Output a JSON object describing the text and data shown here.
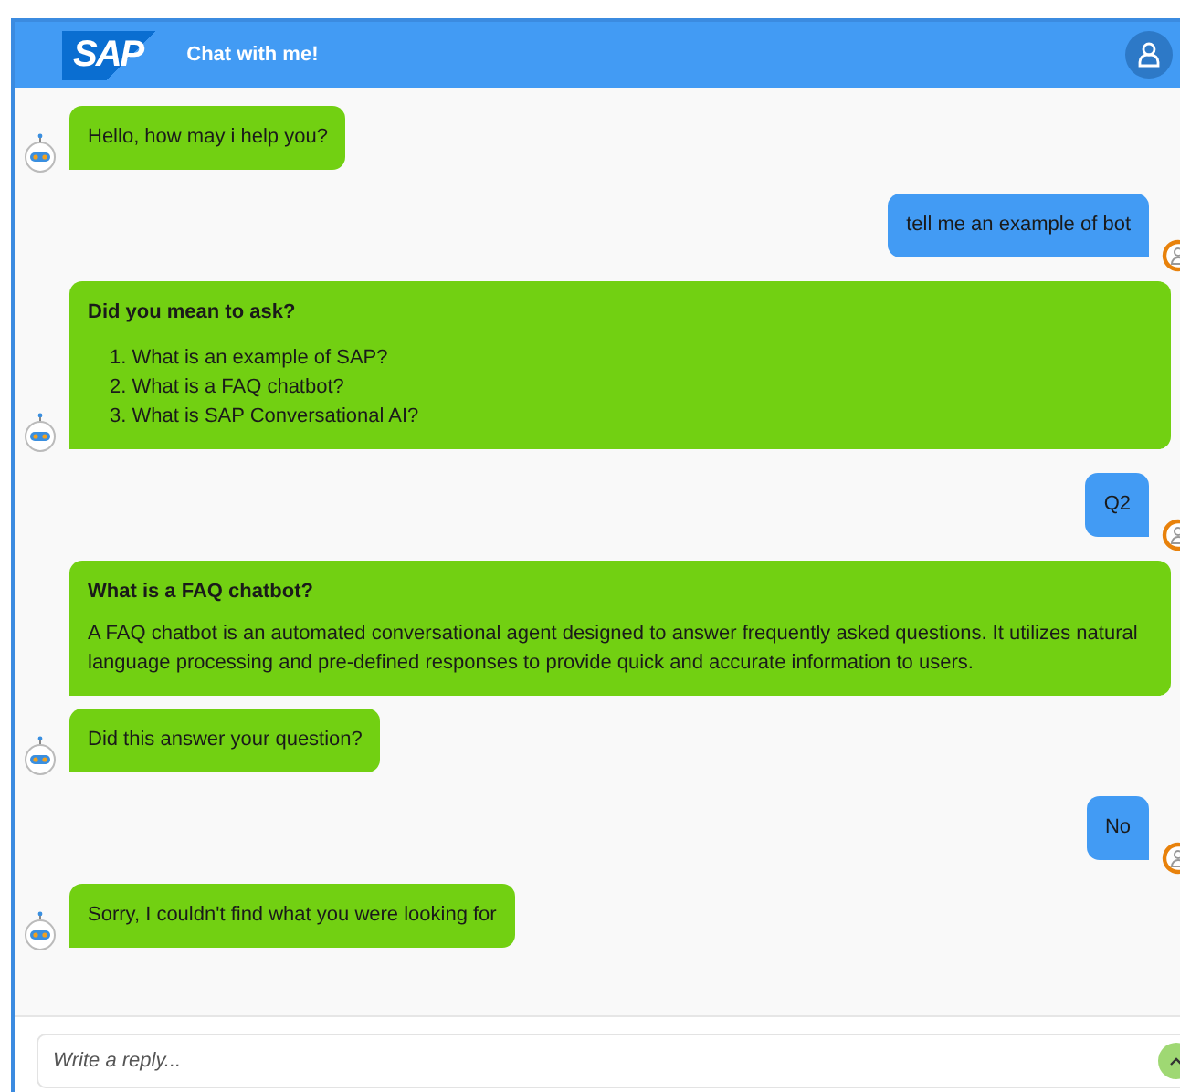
{
  "header": {
    "logo": "SAP",
    "title": "Chat with me!"
  },
  "messages": [
    {
      "kind": "bot",
      "bubbles": [
        {
          "kind": "text",
          "text": "Hello, how may i help you?"
        }
      ]
    },
    {
      "kind": "user",
      "bubbles": [
        {
          "kind": "text",
          "text": "tell me an example of bot"
        }
      ]
    },
    {
      "kind": "bot",
      "bubbles": [
        {
          "kind": "list",
          "title": "Did you mean to ask?",
          "items": [
            {
              "number": "1.",
              "text": "What is an example of SAP?"
            },
            {
              "number": "2.",
              "text": "What is a FAQ chatbot?"
            },
            {
              "number": "3.",
              "text": "What is SAP Conversational AI?"
            }
          ]
        }
      ]
    },
    {
      "kind": "user",
      "bubbles": [
        {
          "kind": "text",
          "text": "Q2"
        }
      ]
    },
    {
      "kind": "bot",
      "bubbles": [
        {
          "kind": "article",
          "title": "What is a FAQ chatbot?",
          "body": "A FAQ chatbot is an automated conversational agent designed to answer frequently asked questions. It utilizes natural language processing and pre-defined responses to provide quick and accurate information to users."
        },
        {
          "kind": "text",
          "text": "Did this answer your question?"
        }
      ]
    },
    {
      "kind": "user",
      "bubbles": [
        {
          "kind": "text",
          "text": "No"
        }
      ]
    },
    {
      "kind": "bot",
      "bubbles": [
        {
          "kind": "text",
          "text": "Sorry, I couldn't find what you were looking for"
        }
      ]
    }
  ],
  "composer": {
    "placeholder": "Write a reply..."
  }
}
